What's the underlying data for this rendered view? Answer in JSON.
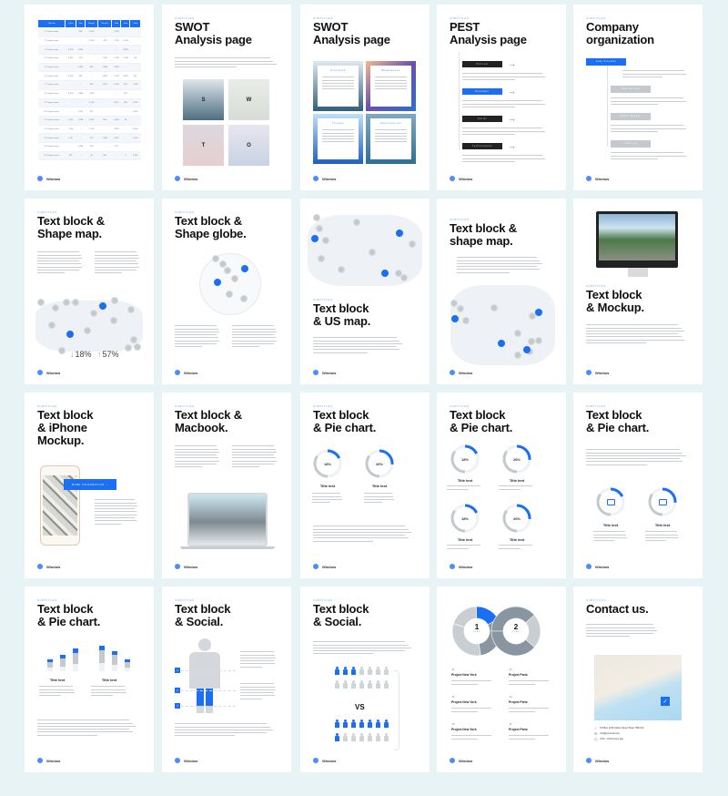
{
  "brand": {
    "name": "Window",
    "accent": "#1a6ff5",
    "background": "#e8f3f5"
  },
  "subtitle": "Subtitles",
  "lorem": "Lorem ipsum dolor sit amet, consectetur adipiscing elit, sed do eiusmod tempor incididunt ut labore et dolore magna aliqua.",
  "slides": [
    {
      "id": 1,
      "type": "table",
      "table": {
        "headers": [
          "Title text",
          "Label",
          "Title",
          "Margin",
          "Results",
          "Sold",
          "Sum",
          "Code"
        ],
        "rows": [
          [
            "1. Project name",
            "-",
            "980",
            "1,050",
            "-",
            "3,299",
            "-",
            "-"
          ],
          [
            "2. Project name",
            "-",
            "-",
            "2,749",
            "490",
            "1,299",
            "2,099",
            "-"
          ],
          [
            "3. Project name",
            "3,876",
            "4,900",
            "-",
            "-",
            "-",
            "3,899",
            "-"
          ],
          [
            "4. Project name",
            "3,875",
            "219",
            "-",
            "1,997",
            "2,299",
            "1,399",
            "69"
          ],
          [
            "5. Project name",
            "-",
            "2,987",
            "986",
            "1,988",
            "2,999",
            "-",
            "-"
          ],
          [
            "6. Project name",
            "3,876",
            "390",
            "-",
            "4,990",
            "1,199",
            "4,987",
            "567"
          ],
          [
            "7. Project name",
            "-",
            "-",
            "980",
            "1,997",
            "2,299",
            "853",
            "1,299"
          ],
          [
            "8. Project name",
            "3,876",
            "4,989",
            "1,499",
            "-",
            "-",
            "679",
            "-"
          ],
          [
            "9. Project name",
            "-",
            "-",
            "2,799",
            "-",
            "6,970",
            "853",
            "4,290"
          ],
          [
            "10. Project name",
            "-",
            "2,097",
            "597",
            "-",
            "-",
            "-",
            "3,299"
          ],
          [
            "11. Project name",
            "2,765",
            "2,990",
            "2,907",
            "654",
            "5,098",
            "99",
            "-"
          ],
          [
            "12. Project name",
            "1,765",
            "-",
            "1,750",
            "-",
            "3,299",
            "-",
            "4,290"
          ],
          [
            "13. Project name",
            "2,097",
            "-",
            "579",
            "2,980",
            "2,097",
            "-",
            "2,290"
          ],
          [
            "14. Project name",
            "-",
            "1,890",
            "206",
            "-",
            "679",
            "-",
            "-"
          ],
          [
            "15. Project name",
            "597",
            "-",
            "30",
            "980",
            "-",
            "3",
            "4,290"
          ]
        ]
      }
    },
    {
      "id": 2,
      "type": "swot-photos",
      "title": "SWOT\nAnalysis page",
      "letters": [
        "S",
        "W",
        "T",
        "O"
      ]
    },
    {
      "id": 3,
      "type": "swot-cards",
      "title": "SWOT\nAnalysis page",
      "cards": [
        "Strengths",
        "Weaknesses",
        "Threats",
        "Opportunities"
      ]
    },
    {
      "id": 4,
      "type": "pest",
      "title": "PEST\nAnalysis page",
      "items": [
        "Political",
        "Economic",
        "Social",
        "Technological"
      ]
    },
    {
      "id": 5,
      "type": "org",
      "title": "Company\norganization",
      "items": [
        "Andy Freeman",
        "Position One",
        "Robert Morgan",
        "Lucy Lee"
      ]
    },
    {
      "id": 6,
      "type": "world-map",
      "title": "Text block &\nShape map.",
      "stats": [
        {
          "dir": "down",
          "value": "18%"
        },
        {
          "dir": "up",
          "value": "57%"
        }
      ]
    },
    {
      "id": 7,
      "type": "globe",
      "title": "Text block &\nShape globe."
    },
    {
      "id": 8,
      "type": "us-map",
      "title": "Text block\n& US map."
    },
    {
      "id": 9,
      "type": "china-map",
      "title": "Text block &\nshape map."
    },
    {
      "id": 10,
      "type": "mockup",
      "title": "Text block\n& Mockup."
    },
    {
      "id": 11,
      "type": "iphone",
      "title": "Text block\n& iPhone\nMockup.",
      "button": "More information →"
    },
    {
      "id": 12,
      "type": "macbook",
      "title": "Text block &\nMacbook."
    },
    {
      "id": 13,
      "type": "pie2",
      "title": "Text block\n& Pie chart.",
      "charts": [
        {
          "value": 18,
          "label": "18%",
          "title": "Title text"
        },
        {
          "value": 26,
          "label": "26%",
          "title": "Title text"
        }
      ]
    },
    {
      "id": 14,
      "type": "pie4",
      "title": "Text block\n& Pie chart.",
      "charts": [
        {
          "value": 18,
          "label": "18%",
          "title": "Title text"
        },
        {
          "value": 26,
          "label": "26%",
          "title": "Title text"
        },
        {
          "value": 18,
          "label": "18%",
          "title": "Title text"
        },
        {
          "value": 26,
          "label": "26%",
          "title": "Title text"
        }
      ]
    },
    {
      "id": 15,
      "type": "pie-icons",
      "title": "Text block\n& Pie chart.",
      "charts": [
        {
          "value": 18,
          "icon": "chat-icon",
          "title": "Title text"
        },
        {
          "value": 26,
          "icon": "calendar-icon",
          "title": "Title text"
        }
      ]
    },
    {
      "id": 16,
      "type": "bars",
      "title": "Text block\n& Pie chart.",
      "groups": [
        {
          "title": "Title text",
          "values": [
            0.45,
            0.6,
            0.85
          ]
        },
        {
          "title": "Title text",
          "values": [
            0.95,
            0.75,
            0.45
          ]
        }
      ]
    },
    {
      "id": 17,
      "type": "social-person",
      "title": "Text block\n& Social.",
      "markers": [
        "1",
        "2",
        "3"
      ]
    },
    {
      "id": 18,
      "type": "social-vs",
      "title": "Text block\n& Social.",
      "vs": "VS",
      "top_highlighted": 3,
      "bottom_highlighted": 8,
      "per_group": 14
    },
    {
      "id": 19,
      "type": "steps",
      "steps": [
        {
          "num": "1",
          "label": "Step"
        },
        {
          "num": "2",
          "label": "Step"
        }
      ],
      "projects": [
        {
          "num": ".01",
          "title": "Project New York"
        },
        {
          "num": ".02",
          "title": "Project Paris"
        },
        {
          "num": ".03",
          "title": "Project New York"
        },
        {
          "num": ".04",
          "title": "Project Paris"
        },
        {
          "num": ".05",
          "title": "Project New York"
        },
        {
          "num": ".06",
          "title": "Project Paris"
        }
      ]
    },
    {
      "id": 20,
      "type": "contact",
      "title": "Contact us.",
      "contacts": [
        {
          "icon": "check-icon",
          "text": "PO Box 1234 Collins Street Tower 789 KS4"
        },
        {
          "icon": "mail-icon",
          "text": "info@yourmail.com"
        },
        {
          "icon": "clock-icon",
          "text": "8:00 – 19:00 every day"
        }
      ]
    }
  ]
}
